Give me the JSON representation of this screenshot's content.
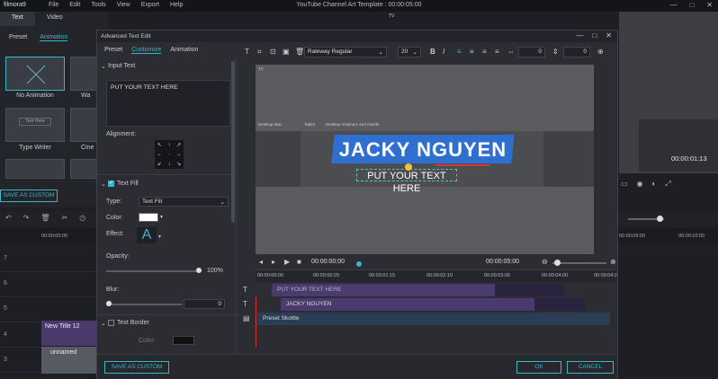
{
  "app": {
    "logo": "filmora9",
    "menu": [
      "File",
      "Edit",
      "Tools",
      "View",
      "Export",
      "Help"
    ],
    "window_title": "YouTube Channel Art Template : 00:00:05:00",
    "win_controls": [
      "—",
      "□",
      "✕"
    ]
  },
  "library": {
    "tabs": [
      "Text",
      "Video"
    ],
    "subtabs": [
      "Preset",
      "Animation"
    ],
    "thumbs": [
      "No Animation",
      "Wa",
      "Type Writer",
      "Cine"
    ],
    "save_custom": "SAVE AS CUSTOM"
  },
  "right_preview": {
    "time": "00:00:01:13",
    "corner_label": "TV"
  },
  "main_timeline": {
    "ruler": [
      "00:00:00:00",
      "00:00:09:00",
      "00:00:10:00"
    ],
    "tracks": [
      {
        "num": "7"
      },
      {
        "num": "6"
      },
      {
        "num": "5"
      },
      {
        "num": "4",
        "clip": "New Title 12"
      },
      {
        "num": "3",
        "clip": "unnamed"
      }
    ]
  },
  "dialog": {
    "title": "Advanced Text Edit",
    "tabs": [
      "Preset",
      "Customize",
      "Animation"
    ],
    "input_text_label": "Input Text",
    "input_text_value": "PUT YOUR TEXT HERE",
    "alignment_label": "Alignment:",
    "text_fill_label": "Text Fill",
    "type_label": "Type:",
    "type_value": "Text Fill",
    "color_label": "Color:",
    "effect_label": "Effect:",
    "effect_glyph": "A",
    "opacity_label": "Opacity:",
    "opacity_value": 100,
    "opacity_text": "100%",
    "blur_label": "Blur:",
    "blur_value": "0",
    "text_border_label": "Text Border",
    "border_color_label": "Color:",
    "font": "Raleway Regular",
    "font_size": "20",
    "spacing1": "0",
    "spacing2": "0",
    "canvas": {
      "tv_label": "TV",
      "desktop_max": "Desktop Max",
      "tablet": "Tablet",
      "desktop_min_mobile": "Desktop minimum and mobile",
      "headline": "JACKY NGUYEN",
      "subtitle": "PUT YOUR TEXT HERE"
    },
    "playback_time": "00:00:00:00",
    "playback_total": "00:00:05:00",
    "ruler": [
      "00:00:00:00",
      "00:00:00:20",
      "00:00:01:15",
      "00:00:02:10",
      "00:00:03:05",
      "00:00:04:00",
      "00:00:04:2"
    ],
    "clips": [
      "PUT YOUR TEXT HERE",
      "JACKY NGUYEN",
      "Preset Skottle"
    ],
    "save_custom": "SAVE AS CUSTOM",
    "ok": "OK",
    "cancel": "CANCEL"
  },
  "colors": {
    "accent": "#3bb6c9",
    "banner": "#2f6fcf",
    "clip_purple": "#4a3a6e",
    "clip_blue": "#2a3d55"
  }
}
